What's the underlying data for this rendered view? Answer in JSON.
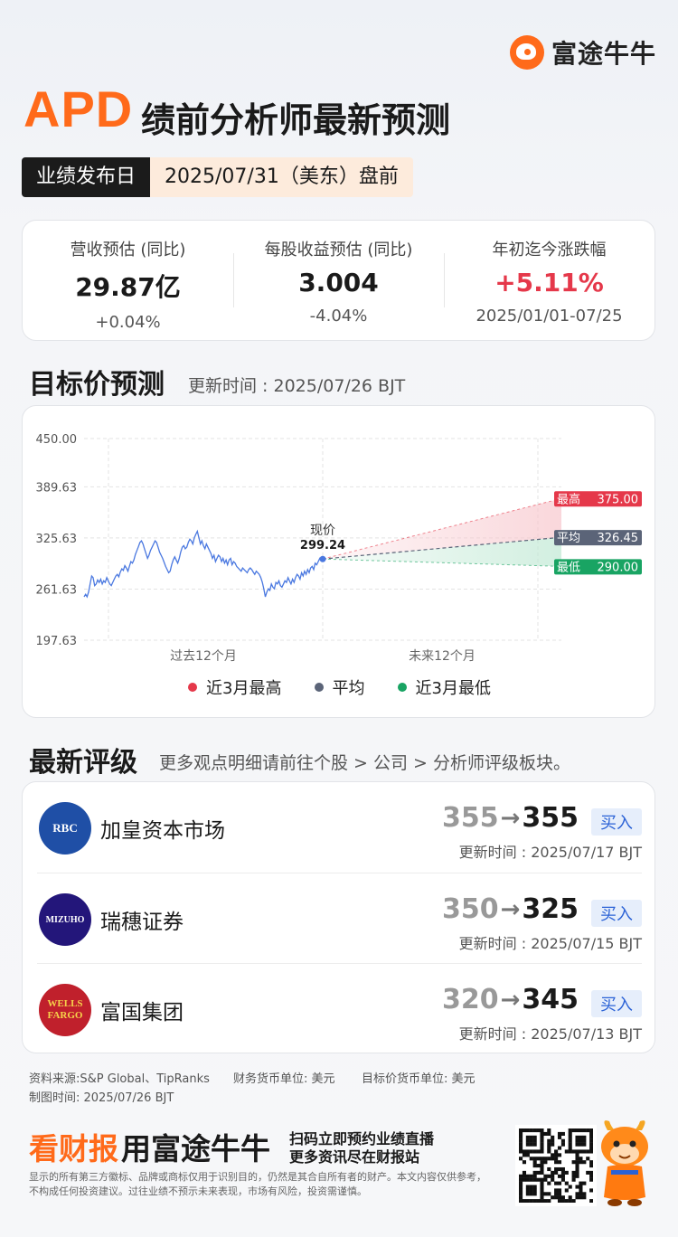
{
  "brand": {
    "name": "富途牛牛",
    "logo_icon": "futu-logo-icon"
  },
  "header": {
    "ticker": "APD",
    "title": "绩前分析师最新预测"
  },
  "release": {
    "label": "业绩发布日",
    "value": "2025/07/31（美东）盘前"
  },
  "stats": [
    {
      "label": "营收预估 (同比)",
      "value": "29.87亿",
      "sub": "+0.04%",
      "tone": "neutral"
    },
    {
      "label": "每股收益预估 (同比)",
      "value": "3.004",
      "sub": "-4.04%",
      "tone": "neutral"
    },
    {
      "label": "年初迄今涨跌幅",
      "value": "+5.11%",
      "sub": "2025/01/01-07/25",
      "tone": "up"
    }
  ],
  "target_section": {
    "title": "目标价预测",
    "updated": "更新时间 : 2025/07/26 BJT"
  },
  "chart_data": {
    "type": "line",
    "y_ticks": [
      "450.00",
      "389.63",
      "325.63",
      "261.63",
      "197.63"
    ],
    "ylim": [
      197.63,
      450.0
    ],
    "x_labels": [
      "过去12个月",
      "未来12个月"
    ],
    "current": {
      "label": "现价",
      "value": 299.24
    },
    "history": [
      252,
      255,
      252,
      258,
      268,
      278,
      276,
      266,
      268,
      273,
      270,
      274,
      268,
      272,
      270,
      276,
      272,
      268,
      266,
      270,
      274,
      278,
      280,
      277,
      283,
      287,
      285,
      291,
      288,
      284,
      290,
      296,
      294,
      298,
      305,
      310,
      315,
      320,
      322,
      318,
      312,
      306,
      300,
      304,
      310,
      314,
      318,
      322,
      320,
      314,
      308,
      304,
      300,
      295,
      290,
      286,
      282,
      284,
      292,
      298,
      302,
      298,
      294,
      300,
      308,
      314,
      316,
      312,
      314,
      320,
      324,
      322,
      318,
      326,
      330,
      334,
      326,
      318,
      322,
      316,
      312,
      318,
      314,
      310,
      306,
      300,
      304,
      296,
      300,
      304,
      302,
      296,
      300,
      294,
      298,
      292,
      298,
      300,
      292,
      296,
      294,
      290,
      288,
      286,
      284,
      288,
      286,
      284,
      282,
      286,
      288,
      286,
      283,
      280,
      284,
      282,
      280,
      276,
      270,
      262,
      252,
      258,
      262,
      260,
      268,
      264,
      262,
      270,
      268,
      272,
      266,
      264,
      268,
      272,
      270,
      276,
      272,
      268,
      274,
      270,
      276,
      280,
      278,
      274,
      282,
      278,
      284,
      280,
      286,
      282,
      288,
      290,
      286,
      294,
      292,
      296,
      300,
      297,
      299.24
    ],
    "forecast": {
      "high": {
        "label": "最高",
        "value": "375.00",
        "v": 375.0
      },
      "avg": {
        "label": "平均",
        "value": "326.45",
        "v": 326.45
      },
      "low": {
        "label": "最低",
        "value": "290.00",
        "v": 290.0
      }
    },
    "legend": [
      {
        "name": "近3月最高",
        "color": "#e5384a"
      },
      {
        "name": "平均",
        "color": "#5b6478"
      },
      {
        "name": "近3月最低",
        "color": "#19a463"
      }
    ],
    "grid": true
  },
  "ratings_section": {
    "title": "最新评级",
    "note": "更多观点明细请前往个股 > 公司 > 分析师评级板块。"
  },
  "ratings": [
    {
      "firm": "加皇资本市场",
      "logo_text": "RBC",
      "logo_color": "#1f4fa6",
      "old": "355",
      "new": "355",
      "rating": "买入",
      "updated": "更新时间 : 2025/07/17 BJT"
    },
    {
      "firm": "瑞穗证券",
      "logo_text": "MIZUHO",
      "logo_color": "#23167a",
      "old": "350",
      "new": "325",
      "rating": "买入",
      "updated": "更新时间 : 2025/07/15 BJT"
    },
    {
      "firm": "富国集团",
      "logo_text": "WELLS FARGO",
      "logo_color": "#c0202c",
      "old": "320",
      "new": "345",
      "rating": "买入",
      "updated": "更新时间 : 2025/07/13 BJT"
    }
  ],
  "arrow_glyph": "→",
  "footer": {
    "source": "资料来源:S&P Global、TipRanks",
    "currency_fin": "财务货币单位: 美元",
    "currency_target": "目标价货币单位: 美元",
    "made_time": "制图时间: 2025/07/26 BJT",
    "promo_accent": "看财报",
    "promo_main": "用富途牛牛",
    "promo_line1": "扫码立即预约业绩直播",
    "promo_line2": "更多资讯尽在财报站",
    "disclaimer": "显示的所有第三方徽标、品牌或商标仅用于识别目的，仍然是其合自所有者的财产。本文内容仅供参考，不构成任何投资建议。过往业绩不预示未来表现，市场有风险，投资需谨慎。"
  }
}
